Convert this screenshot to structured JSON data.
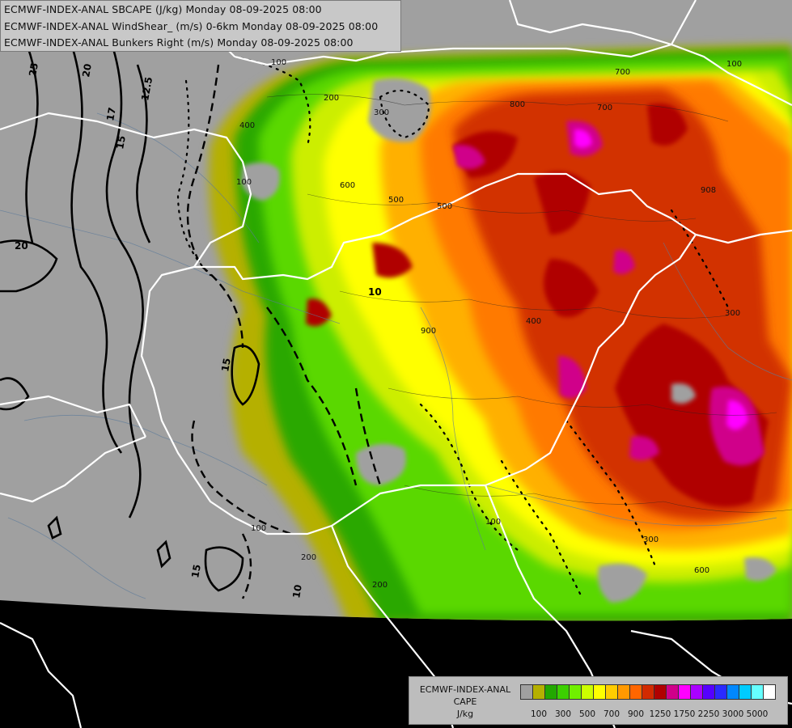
{
  "titles": {
    "line1": "ECMWF-INDEX-ANAL SBCAPE (J/kg) Monday 08-09-2025 08:00",
    "line2": "ECMWF-INDEX-ANAL WindShear_ (m/s) 0-6km Monday 08-09-2025 08:00",
    "line3": "ECMWF-INDEX-ANAL Bunkers Right (m/s) Monday 08-09-2025 08:00"
  },
  "legend": {
    "title_line1": "ECMWF-INDEX-ANAL",
    "title_line2": "CAPE",
    "title_line3": "J/kg",
    "colors": [
      "#a0a0a0",
      "#b5b000",
      "#22a800",
      "#3cd000",
      "#70f000",
      "#ccff00",
      "#ffff00",
      "#ffcc00",
      "#ff9900",
      "#ff6600",
      "#d22a00",
      "#b00000",
      "#d0008a",
      "#ff00ff",
      "#aa00ff",
      "#5500ff",
      "#2a2aff",
      "#0088ff",
      "#00ccff",
      "#66ffff",
      "#ffffff"
    ],
    "ticks": [
      "100",
      "300",
      "500",
      "700",
      "900",
      "1250",
      "1750",
      "2250",
      "3000",
      "5000"
    ]
  },
  "contour_labels": {
    "shear": [
      "25",
      "20",
      "17",
      "15",
      "12.5",
      "20",
      "15",
      "15",
      "10",
      "10"
    ],
    "cape": [
      "100",
      "100",
      "400",
      "600",
      "500",
      "300",
      "200",
      "700",
      "800",
      "900",
      "908",
      "700",
      "600",
      "500",
      "400",
      "200",
      "300",
      "100",
      "100",
      "200",
      "300",
      "100"
    ]
  },
  "colors": {
    "border": "#ffffff",
    "background_no_cape": "#a0a0a0",
    "outside_domain": "#000000"
  }
}
